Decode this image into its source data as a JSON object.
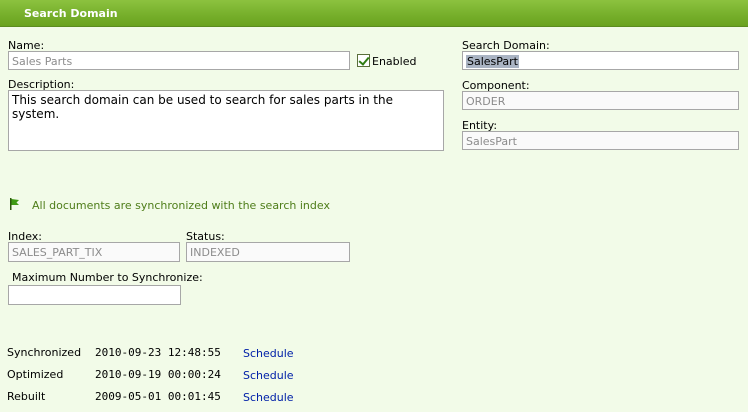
{
  "header": {
    "title": "Search Domain"
  },
  "form": {
    "name_label": "Name:",
    "name_value": "Sales Parts",
    "enabled_label": "Enabled",
    "enabled_checked": true,
    "description_label": "Description:",
    "description_value": "This search domain can be used to search for sales parts in the system.",
    "search_domain_label": "Search Domain:",
    "search_domain_value": "SalesPart",
    "component_label": "Component:",
    "component_value": "ORDER",
    "entity_label": "Entity:",
    "entity_value": "SalesPart"
  },
  "sync_message": "All documents are synchronized with the search index",
  "index": {
    "index_label": "Index:",
    "index_value": "SALES_PART_TIX",
    "status_label": "Status:",
    "status_value": "INDEXED",
    "max_sync_label": "Maximum Number to Synchronize:",
    "max_sync_value": ""
  },
  "schedule_rows": [
    {
      "label": "Synchronized",
      "datetime": "2010-09-23 12:48:55",
      "link": "Schedule"
    },
    {
      "label": "Optimized",
      "datetime": "2010-09-19 00:00:24",
      "link": "Schedule"
    },
    {
      "label": "Rebuilt",
      "datetime": "2009-05-01 00:01:45",
      "link": "Schedule"
    }
  ],
  "colors": {
    "header_green": "#77b02c",
    "background": "#f2fbe8",
    "link_blue": "#0020a8",
    "message_green": "#4e7d19"
  }
}
